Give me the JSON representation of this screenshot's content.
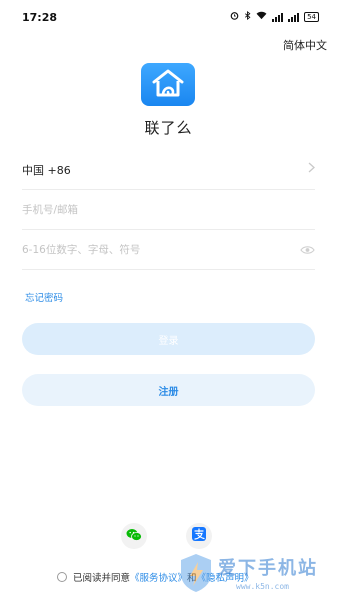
{
  "status_bar": {
    "time": "17:28",
    "battery": "54"
  },
  "header": {
    "language_switch": "简体中文"
  },
  "app": {
    "name": "联了么"
  },
  "form": {
    "country_code": "中国 +86",
    "phone_placeholder": "手机号/邮箱",
    "password_placeholder": "6-16位数字、字母、符号",
    "forgot_password": "忘记密码"
  },
  "buttons": {
    "login": "登录",
    "register": "注册"
  },
  "agreement": {
    "prefix": "已阅读并同意",
    "service_link": "《服务协议》",
    "and": "和",
    "privacy_link": "《隐私声明》"
  },
  "watermark": {
    "main": "爱下手机站",
    "sub": "www.k5n.com"
  },
  "colors": {
    "accent": "#2b8be6",
    "login_disabled": "#dcedfc",
    "register_bg": "#e9f3fc",
    "wechat": "#09bb07",
    "alipay": "#1677ff"
  },
  "icons": [
    "alarm-icon",
    "bluetooth-icon",
    "wifi-icon",
    "signal-icon",
    "battery-icon",
    "chevron-right-icon",
    "eye-icon",
    "wechat-icon",
    "alipay-icon",
    "home-logo-icon"
  ]
}
